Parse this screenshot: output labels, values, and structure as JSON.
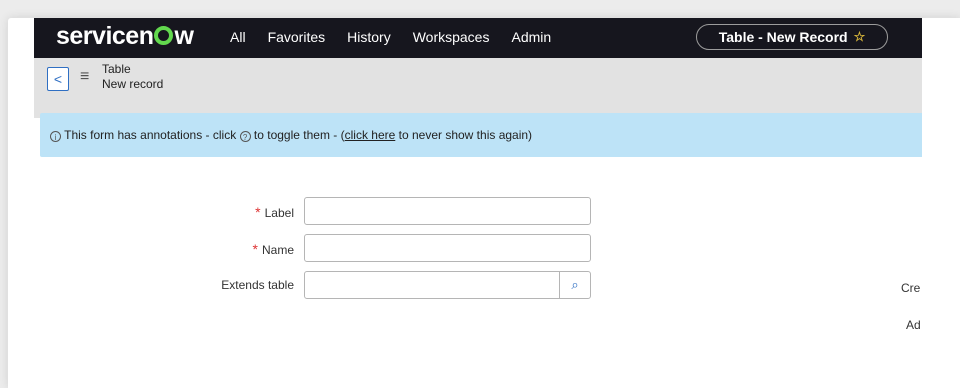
{
  "topbar": {
    "brand_pre": "servicen",
    "brand_post": "w",
    "nav": [
      "All",
      "Favorites",
      "History",
      "Workspaces",
      "Admin"
    ],
    "record_title": "Table - New Record"
  },
  "header": {
    "line1": "Table",
    "line2": "New record"
  },
  "info": {
    "text_a": "This form has annotations - click",
    "text_b": "to toggle them - (",
    "link": "click here",
    "text_c": "to never show this again)"
  },
  "form": {
    "label_field": "Label",
    "name_field": "Name",
    "extends_field": "Extends table",
    "label_value": "",
    "name_value": "",
    "extends_value": ""
  },
  "right": {
    "cre": "Cre",
    "ad": "Ad"
  }
}
